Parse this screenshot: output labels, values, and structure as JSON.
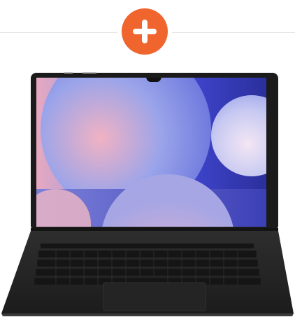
{
  "add_button": {
    "icon": "plus-icon",
    "color": "#f0642d"
  },
  "product_image": {
    "icon": "laptop-icon",
    "bezel_color": "#1b1b1b",
    "keyboard_color": "#262626",
    "screen_colors": [
      "#f2a8b8",
      "#8f9ae8",
      "#4b56d6",
      "#c9c6f2"
    ]
  }
}
